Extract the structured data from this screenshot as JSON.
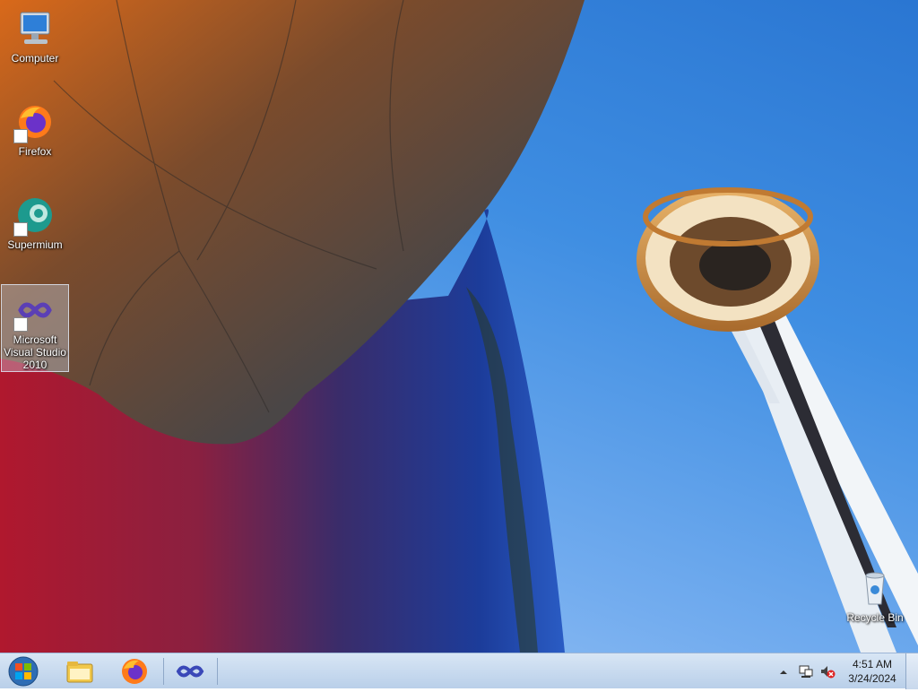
{
  "desktop": {
    "icons": [
      {
        "label": "Computer",
        "icon": "computer-icon"
      },
      {
        "label": "Firefox",
        "icon": "firefox-icon"
      },
      {
        "label": "Supermium",
        "icon": "supermium-icon"
      },
      {
        "label": "Microsoft Visual Studio 2010",
        "icon": "visual-studio-icon"
      },
      {
        "label": "Recycle Bin",
        "icon": "recycle-bin-icon"
      }
    ]
  },
  "taskbar": {
    "start": {
      "icon": "windows-start-icon"
    },
    "pinned": [
      {
        "name": "Windows Explorer",
        "icon": "explorer-folder-icon"
      },
      {
        "name": "Firefox",
        "icon": "firefox-icon"
      },
      {
        "name": "Microsoft Visual Studio 2010",
        "icon": "visual-studio-icon"
      }
    ],
    "tray": {
      "show_hidden": "show-hidden-icons-arrow",
      "network": "network-icon",
      "volume": "volume-muted-icon"
    },
    "clock": {
      "time": "4:51 AM",
      "date": "3/24/2024"
    }
  },
  "colors": {
    "taskbar_top": "#d8e6f5",
    "taskbar_bottom": "#b9cfe9",
    "sky": "#3f8ee2"
  }
}
